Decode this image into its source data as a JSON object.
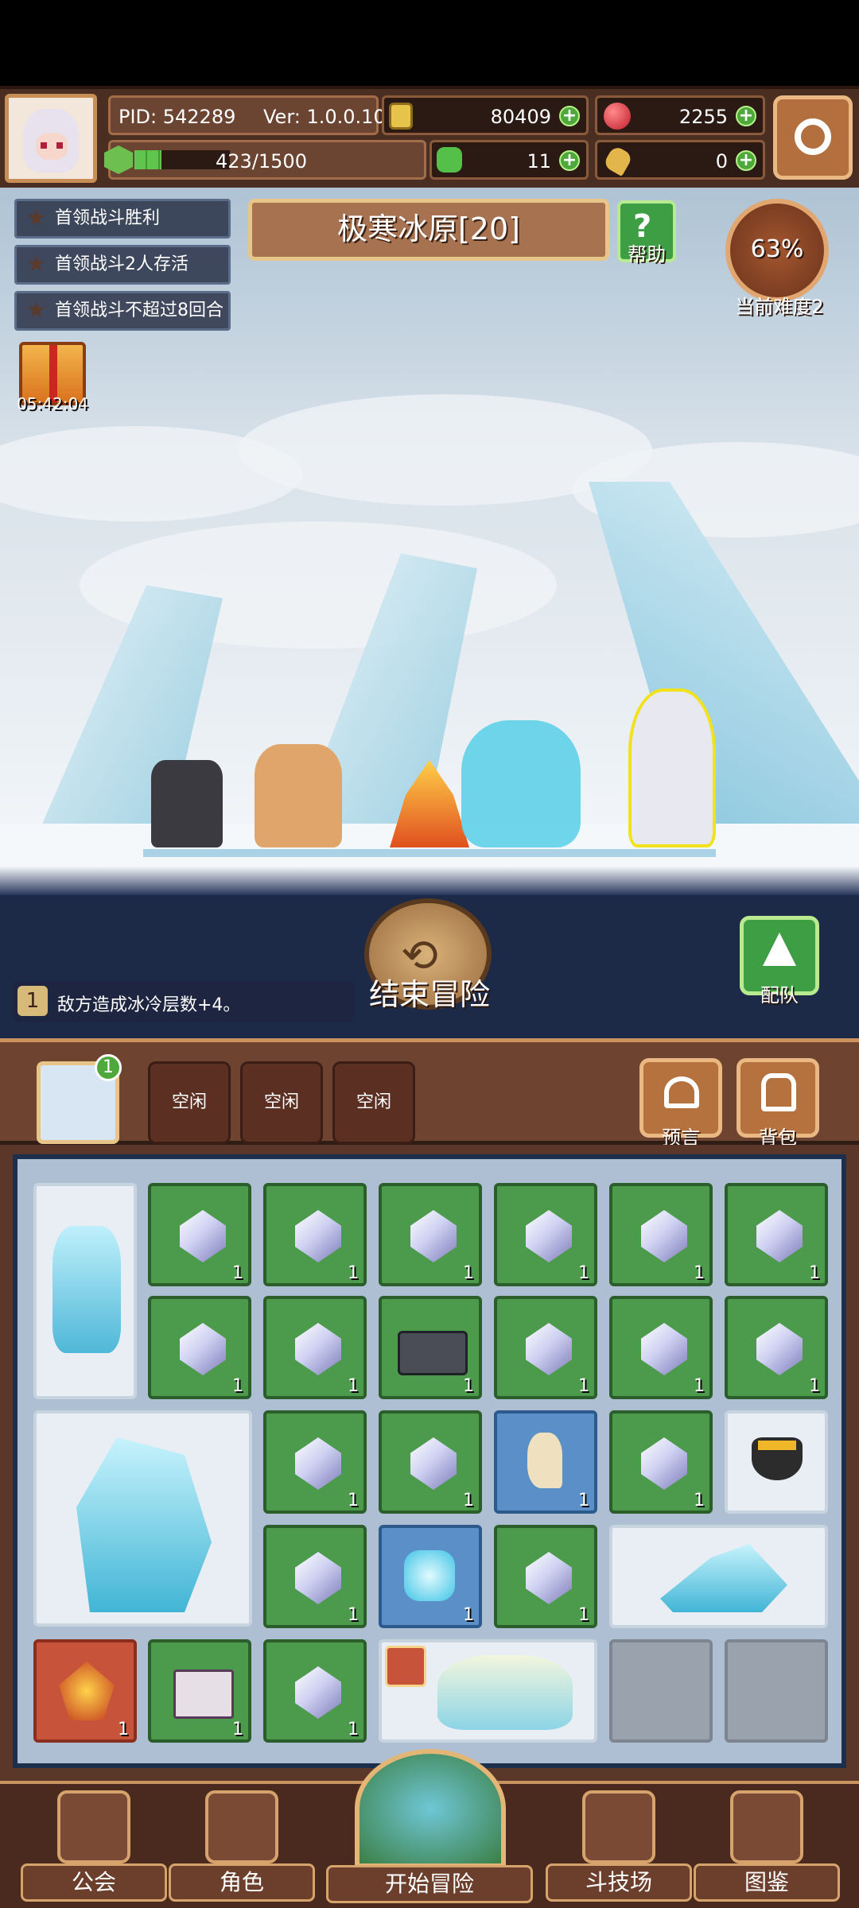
{
  "header": {
    "pid": "PID: 542289",
    "version": "Ver: 1.0.0.10",
    "gold": "80409",
    "gems": "2255",
    "energy": "423/1500",
    "energy_fraction": 0.28,
    "clover": "11",
    "bones": "0"
  },
  "quests": [
    "首领战斗胜利",
    "首领战斗2人存活",
    "首领战斗不超过8回合"
  ],
  "gift_timer": "05:42:04",
  "stage": {
    "title": "极寒冰原[20]",
    "help_label": "帮助",
    "progress": "63%",
    "difficulty": "当前难度2"
  },
  "actions": {
    "end_adventure": "结束冒险",
    "team": "配队",
    "effect_index": "1",
    "effect_text": "敌方造成冰冷层数+4。"
  },
  "slots": {
    "badge": "1",
    "idle": [
      "空闲",
      "空闲",
      "空闲"
    ],
    "forecast": "预言",
    "backpack": "背包"
  },
  "inventory": {
    "count": "1"
  },
  "nav": [
    "公会",
    "角色",
    "开始冒险",
    "斗技场",
    "图鉴"
  ],
  "colors": {
    "topbar": "#4a2e22",
    "green_cell": "#4c9a4b",
    "blue_cell": "#5a8fc7",
    "accent_gold": "#e8c68a"
  }
}
